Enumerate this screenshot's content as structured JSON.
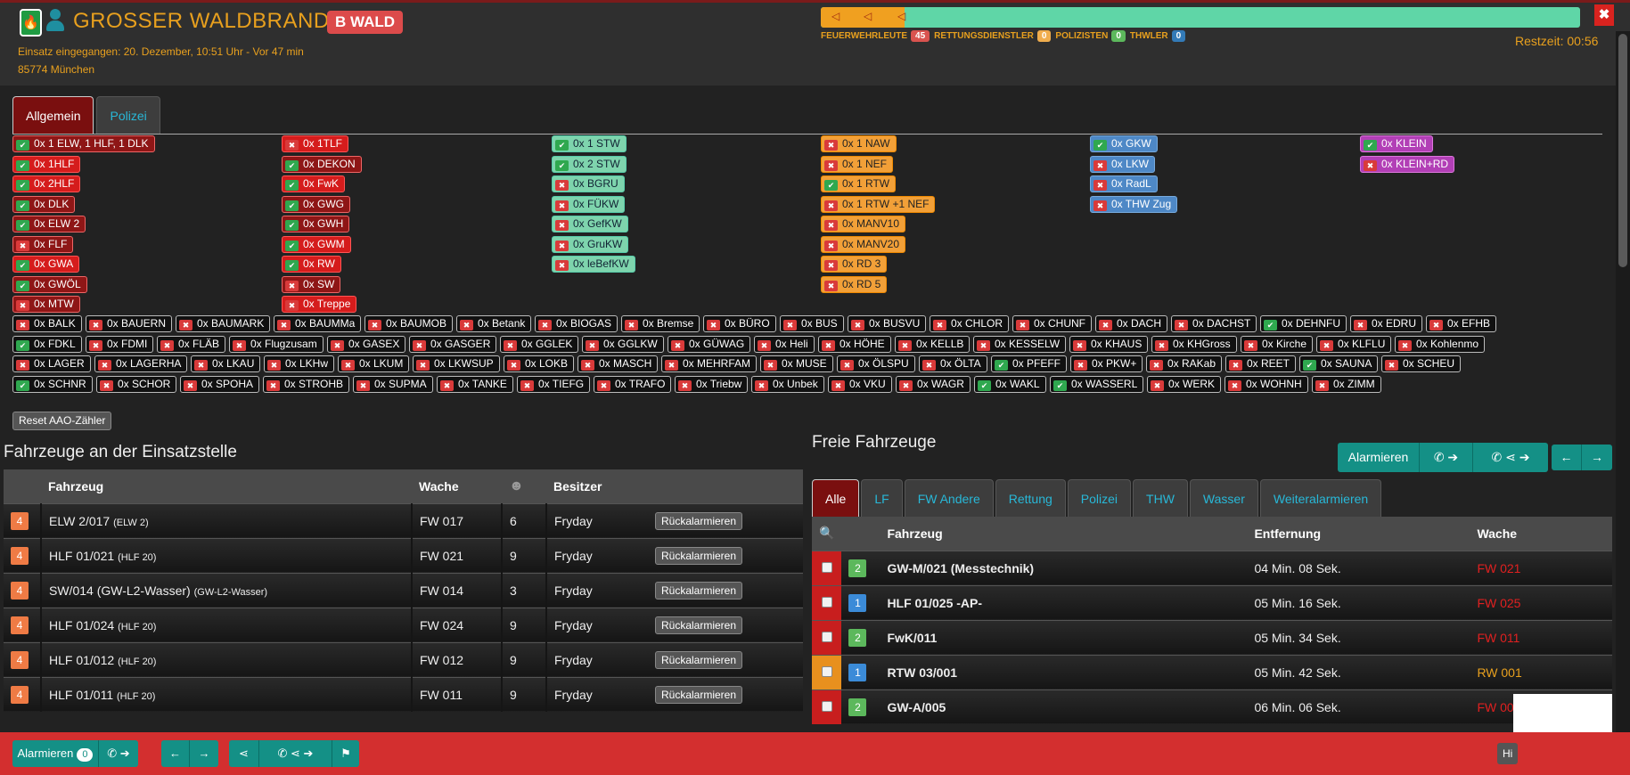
{
  "header": {
    "title": "GROSSER WALDBRAND",
    "badge": "B WALD",
    "received": "Einsatz eingegangen: 20. Dezember, 10:51 Uhr - Vor 47 min",
    "address": "85774 München",
    "restzeit": "Restzeit: 00:56",
    "progress_fraction": 0.11,
    "colors": {
      "accent": "#e8a01e",
      "badge": "#dc4b4b"
    }
  },
  "personnel": [
    {
      "label": "FEUERWEHRLEUTE",
      "count": "45",
      "color": "#d9534f"
    },
    {
      "label": "RETTUNGSDIENSTLER",
      "count": "0",
      "color": "#f0ad4e"
    },
    {
      "label": "POLIZISTEN",
      "count": "0",
      "color": "#5cb85c"
    },
    {
      "label": "THWLER",
      "count": "0",
      "color": "#337ab7"
    }
  ],
  "tabs": [
    {
      "label": "Allgemein",
      "active": true
    },
    {
      "label": "Polizei",
      "active": false
    }
  ],
  "aao_columns": [
    [
      {
        "label": "0x 1 ELW, 1 HLF, 1 DLK",
        "ok": true,
        "color": "darkred"
      },
      {
        "label": "0x 1HLF",
        "ok": true,
        "color": "red"
      },
      {
        "label": "0x 2HLF",
        "ok": true,
        "color": "red"
      },
      {
        "label": "0x DLK",
        "ok": true,
        "color": "darkred"
      },
      {
        "label": "0x ELW 2",
        "ok": true,
        "color": "darkred"
      },
      {
        "label": "0x FLF",
        "ok": false,
        "color": "darkred"
      },
      {
        "label": "0x GWA",
        "ok": true,
        "color": "red"
      },
      {
        "label": "0x GWÖL",
        "ok": true,
        "color": "darkred"
      },
      {
        "label": "0x MTW",
        "ok": false,
        "color": "darkred"
      }
    ],
    [
      {
        "label": "0x 1TLF",
        "ok": false,
        "color": "red"
      },
      {
        "label": "0x DEKON",
        "ok": true,
        "color": "darkred"
      },
      {
        "label": "0x FwK",
        "ok": true,
        "color": "red"
      },
      {
        "label": "0x GWG",
        "ok": true,
        "color": "darkred"
      },
      {
        "label": "0x GWH",
        "ok": true,
        "color": "darkred"
      },
      {
        "label": "0x GWM",
        "ok": true,
        "color": "red"
      },
      {
        "label": "0x RW",
        "ok": true,
        "color": "red"
      },
      {
        "label": "0x SW",
        "ok": false,
        "color": "darkred"
      },
      {
        "label": "0x Treppe",
        "ok": false,
        "color": "red"
      }
    ],
    [
      {
        "label": "0x 1 STW",
        "ok": true,
        "color": "teal"
      },
      {
        "label": "0x 2 STW",
        "ok": true,
        "color": "teal"
      },
      {
        "label": "0x BGRU",
        "ok": false,
        "color": "teal"
      },
      {
        "label": "0x FÜKW",
        "ok": false,
        "color": "teal"
      },
      {
        "label": "0x GefKW",
        "ok": false,
        "color": "teal"
      },
      {
        "label": "0x GruKW",
        "ok": false,
        "color": "teal"
      },
      {
        "label": "0x leBefKW",
        "ok": false,
        "color": "teal"
      }
    ],
    [
      {
        "label": "0x 1 NAW",
        "ok": false,
        "color": "orange"
      },
      {
        "label": "0x 1 NEF",
        "ok": false,
        "color": "orange"
      },
      {
        "label": "0x 1 RTW",
        "ok": true,
        "color": "orange"
      },
      {
        "label": "0x 1 RTW +1 NEF",
        "ok": false,
        "color": "orange"
      },
      {
        "label": "0x MANV10",
        "ok": false,
        "color": "orange"
      },
      {
        "label": "0x MANV20",
        "ok": false,
        "color": "orange"
      },
      {
        "label": "0x RD 3",
        "ok": false,
        "color": "orange"
      },
      {
        "label": "0x RD 5",
        "ok": false,
        "color": "orange"
      }
    ],
    [
      {
        "label": "0x GKW",
        "ok": true,
        "color": "blue"
      },
      {
        "label": "0x LKW",
        "ok": false,
        "color": "blue"
      },
      {
        "label": "0x RadL",
        "ok": false,
        "color": "blue"
      },
      {
        "label": "0x THW Zug",
        "ok": false,
        "color": "blue"
      }
    ],
    [
      {
        "label": "0x KLEIN",
        "ok": true,
        "color": "purple"
      },
      {
        "label": "0x KLEIN+RD",
        "ok": false,
        "color": "purple"
      }
    ]
  ],
  "aao_rows": [
    [
      {
        "label": "0x BALK",
        "ok": false
      },
      {
        "label": "0x BAUERN",
        "ok": false
      },
      {
        "label": "0x BAUMARK",
        "ok": false
      },
      {
        "label": "0x BAUMMa",
        "ok": false
      },
      {
        "label": "0x BAUMOB",
        "ok": false
      },
      {
        "label": "0x Betank",
        "ok": false
      },
      {
        "label": "0x BIOGAS",
        "ok": false
      },
      {
        "label": "0x Bremse",
        "ok": false
      },
      {
        "label": "0x BÜRO",
        "ok": false
      },
      {
        "label": "0x BUS",
        "ok": false
      },
      {
        "label": "0x BUSVU",
        "ok": false
      },
      {
        "label": "0x CHLOR",
        "ok": false
      },
      {
        "label": "0x CHUNF",
        "ok": false
      },
      {
        "label": "0x DACH",
        "ok": false
      },
      {
        "label": "0x DACHST",
        "ok": false
      },
      {
        "label": "0x DEHNFU",
        "ok": true
      },
      {
        "label": "0x EDRU",
        "ok": false
      },
      {
        "label": "0x EFHB",
        "ok": false
      }
    ],
    [
      {
        "label": "0x FDKL",
        "ok": true
      },
      {
        "label": "0x FDMI",
        "ok": false
      },
      {
        "label": "0x FLÄB",
        "ok": false
      },
      {
        "label": "0x Flugzusam",
        "ok": false
      },
      {
        "label": "0x GASEX",
        "ok": false
      },
      {
        "label": "0x GASGER",
        "ok": false
      },
      {
        "label": "0x GGLEK",
        "ok": false
      },
      {
        "label": "0x GGLKW",
        "ok": false
      },
      {
        "label": "0x GÜWAG",
        "ok": false
      },
      {
        "label": "0x Heli",
        "ok": false
      },
      {
        "label": "0x HÖHE",
        "ok": false
      },
      {
        "label": "0x KELLB",
        "ok": false
      },
      {
        "label": "0x KESSELW",
        "ok": false
      },
      {
        "label": "0x KHAUS",
        "ok": false
      },
      {
        "label": "0x KHGross",
        "ok": false
      },
      {
        "label": "0x Kirche",
        "ok": false
      },
      {
        "label": "0x KLFLU",
        "ok": false
      },
      {
        "label": "0x Kohlenmo",
        "ok": false
      }
    ],
    [
      {
        "label": "0x LAGER",
        "ok": false
      },
      {
        "label": "0x LAGERHA",
        "ok": false
      },
      {
        "label": "0x LKAU",
        "ok": false
      },
      {
        "label": "0x LKHw",
        "ok": false
      },
      {
        "label": "0x LKUM",
        "ok": false
      },
      {
        "label": "0x LKWSUP",
        "ok": false
      },
      {
        "label": "0x LOKB",
        "ok": false
      },
      {
        "label": "0x MASCH",
        "ok": false
      },
      {
        "label": "0x MEHRFAM",
        "ok": false
      },
      {
        "label": "0x MUSE",
        "ok": false
      },
      {
        "label": "0x ÖLSPU",
        "ok": false
      },
      {
        "label": "0x ÖLTA",
        "ok": false
      },
      {
        "label": "0x PFEFF",
        "ok": true
      },
      {
        "label": "0x PKW+",
        "ok": false
      },
      {
        "label": "0x RAKab",
        "ok": false
      },
      {
        "label": "0x REET",
        "ok": false
      },
      {
        "label": "0x SAUNA",
        "ok": true
      },
      {
        "label": "0x SCHEU",
        "ok": false
      }
    ],
    [
      {
        "label": "0x SCHNR",
        "ok": true
      },
      {
        "label": "0x SCHOR",
        "ok": false
      },
      {
        "label": "0x SPOHA",
        "ok": false
      },
      {
        "label": "0x STROHB",
        "ok": false
      },
      {
        "label": "0x SUPMA",
        "ok": false
      },
      {
        "label": "0x TANKE",
        "ok": false
      },
      {
        "label": "0x TIEFG",
        "ok": false
      },
      {
        "label": "0x TRAFO",
        "ok": false
      },
      {
        "label": "0x Triebw",
        "ok": false
      },
      {
        "label": "0x Unbek",
        "ok": false
      },
      {
        "label": "0x VKU",
        "ok": false
      },
      {
        "label": "0x WAGR",
        "ok": false
      },
      {
        "label": "0x WAKL",
        "ok": true
      },
      {
        "label": "0x WASSERL",
        "ok": true
      },
      {
        "label": "0x WERK",
        "ok": false
      },
      {
        "label": "0x WOHNH",
        "ok": false
      },
      {
        "label": "0x ZIMM",
        "ok": false
      }
    ]
  ],
  "reset_label": "Reset AAO-Zähler",
  "on_scene": {
    "title": "Fahrzeuge an der Einsatzstelle",
    "headers": {
      "vehicle": "Fahrzeug",
      "station": "Wache",
      "owner": "Besitzer"
    },
    "back_label": "Rückalarmieren",
    "rows": [
      {
        "status": "4",
        "name": "ELW 2/017",
        "type": "(ELW 2)",
        "station": "FW 017",
        "crew": "6",
        "owner": "Fryday"
      },
      {
        "status": "4",
        "name": "HLF 01/021",
        "type": "(HLF 20)",
        "station": "FW 021",
        "crew": "9",
        "owner": "Fryday"
      },
      {
        "status": "4",
        "name": "SW/014 (GW-L2-Wasser)",
        "type": "(GW-L2-Wasser)",
        "station": "FW 014",
        "crew": "3",
        "owner": "Fryday"
      },
      {
        "status": "4",
        "name": "HLF 01/024",
        "type": "(HLF 20)",
        "station": "FW 024",
        "crew": "9",
        "owner": "Fryday"
      },
      {
        "status": "4",
        "name": "HLF 01/012",
        "type": "(HLF 20)",
        "station": "FW 012",
        "crew": "9",
        "owner": "Fryday"
      },
      {
        "status": "4",
        "name": "HLF 01/011",
        "type": "(HLF 20)",
        "station": "FW 011",
        "crew": "9",
        "owner": "Fryday"
      }
    ]
  },
  "free": {
    "title": "Freie Fahrzeuge",
    "alarm_label": "Alarmieren",
    "tabs": [
      "Alle",
      "LF",
      "FW Andere",
      "Rettung",
      "Polizei",
      "THW",
      "Wasser",
      "Weiteralarmieren"
    ],
    "headers": {
      "vehicle": "Fahrzeug",
      "distance": "Entfernung",
      "station": "Wache"
    },
    "rows": [
      {
        "status": "2",
        "status_color": "#5cb85c",
        "name": "GW-M/021 (Messtechnik)",
        "distance": "04 Min. 08 Sek.",
        "station": "FW 021",
        "station_color": "#e02020",
        "row_color": "#c81e1e"
      },
      {
        "status": "1",
        "status_color": "#3b8bd8",
        "name": "HLF 01/025 -AP-",
        "distance": "05 Min. 16 Sek.",
        "station": "FW 025",
        "station_color": "#e02020",
        "row_color": "#c81e1e"
      },
      {
        "status": "2",
        "status_color": "#5cb85c",
        "name": "FwK/011",
        "distance": "05 Min. 34 Sek.",
        "station": "FW 011",
        "station_color": "#e02020",
        "row_color": "#c81e1e"
      },
      {
        "status": "1",
        "status_color": "#3b8bd8",
        "name": "RTW 03/001",
        "distance": "05 Min. 42 Sek.",
        "station": "RW 001",
        "station_color": "#e8a01e",
        "row_color": "#e8901e"
      },
      {
        "status": "2",
        "status_color": "#5cb85c",
        "name": "GW-A/005",
        "distance": "06 Min. 06 Sek.",
        "station": "FW 005",
        "station_color": "#e02020",
        "row_color": "#c81e1e"
      }
    ]
  },
  "footer": {
    "alarm_label": "Alarmieren",
    "alarm_count": "0",
    "hi_label": "Hi"
  },
  "icons": [
    "fire-icon",
    "person-icon",
    "close-icon",
    "check-icon",
    "x-icon",
    "search-icon",
    "fire-crew-icon",
    "phone-arrow-icon",
    "share-icon",
    "arrow-left-icon",
    "arrow-right-icon",
    "flag-icon"
  ]
}
